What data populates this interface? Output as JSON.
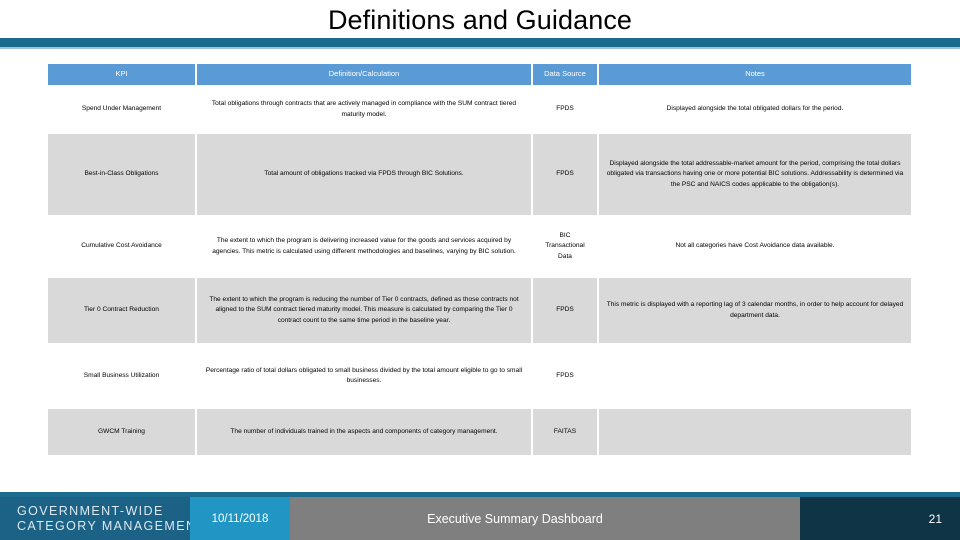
{
  "slide": {
    "title": "Definitions and Guidance"
  },
  "table": {
    "headers": [
      {
        "label": "KPI"
      },
      {
        "label": "Definition/Calculation"
      },
      {
        "label": "Data Source"
      },
      {
        "label": "Notes"
      }
    ],
    "rows": [
      {
        "kpi": "Spend Under Management",
        "definition": "Total obligations through contracts that are actively managed in compliance with the SUM contract tiered maturity model.",
        "data_source": "FPDS",
        "notes": "Displayed alongside the total obligated dollars for the period."
      },
      {
        "kpi": "Best-in-Class Obligations",
        "definition": "Total amount of obligations tracked via FPDS through BIC Solutions.",
        "data_source": "FPDS",
        "notes": "Displayed alongside the total addressable-market amount for the period, comprising the total dollars obligated via transactions having one or more potential BIC solutions.  Addressability is determined via the PSC and NAICS codes applicable to the obligation(s)."
      },
      {
        "kpi": "Cumulative Cost Avoidance",
        "definition": "The extent to which the program is delivering increased value for the goods and services acquired by agencies. This metric is calculated using different methodologies and baselines, varying by BIC solution.",
        "data_source": "BIC Transactional Data",
        "notes": "Not all categories have Cost Avoidance data available."
      },
      {
        "kpi": "Tier 0 Contract Reduction",
        "definition": "The extent to which the program is reducing the number of Tier 0 contracts, defined as those contracts not aligned to the SUM contract tiered maturity model. This measure is calculated by comparing the Tier 0 contract count to the same time period in the baseline year.",
        "data_source": "FPDS",
        "notes": "This metric is displayed with a reporting lag of 3 calendar months, in order to help account for delayed department data."
      },
      {
        "kpi": "Small Business Utilization",
        "definition": "Percentage ratio of total dollars obligated to small business divided by the total amount eligible to go to small businesses.",
        "data_source": "FPDS",
        "notes": ""
      },
      {
        "kpi": "GWCM Training",
        "definition": "The number of individuals trained in the aspects and components of category management.",
        "data_source": "FAITAS",
        "notes": ""
      }
    ]
  },
  "footer": {
    "brand_line1": "GOVERNMENT-WIDE",
    "brand_line2": "CATEGORY MANAGEMENT",
    "date": "10/11/2018",
    "subject": "Executive Summary Dashboard",
    "page_number": "21"
  },
  "colors": {
    "header_blue": "#5b9bd5",
    "rule_teal": "#1a6b8e",
    "band_gray": "#d9d9d9",
    "brand_blue": "#1c6286",
    "date_blue": "#2196c4",
    "subject_gray": "#7f7f7f",
    "pageno_navy": "#0e3445"
  }
}
